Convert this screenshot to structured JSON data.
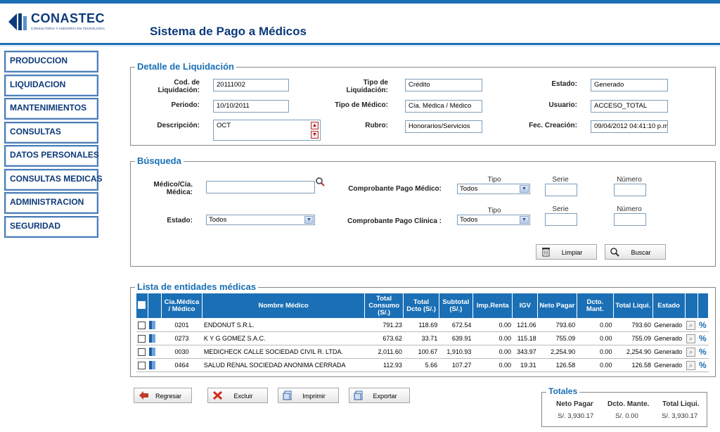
{
  "brand": {
    "name": "CONASTEC",
    "tagline": "CONSULTORIA Y ASESORIA EN TECNOLOGIA"
  },
  "page_title": "Sistema de Pago a Médicos",
  "sidebar": {
    "items": [
      {
        "label": "PRODUCCION"
      },
      {
        "label": "LIQUIDACION"
      },
      {
        "label": "MANTENIMIENTOS"
      },
      {
        "label": "CONSULTAS"
      },
      {
        "label": "DATOS PERSONALES"
      },
      {
        "label": "CONSULTAS MEDICAS"
      },
      {
        "label": "ADMINISTRACION"
      },
      {
        "label": "SEGURIDAD"
      }
    ]
  },
  "detalle": {
    "legend": "Detalle de Liquidación",
    "cod_label": "Cod. de Liquidación:",
    "cod_value": "20111002",
    "periodo_label": "Periodo:",
    "periodo_value": "10/10/2011",
    "desc_label": "Descripción:",
    "desc_value": "OCT",
    "tipo_liq_label": "Tipo de Liquidación:",
    "tipo_liq_value": "Crédito",
    "tipo_med_label": "Tipo de Médico:",
    "tipo_med_value": "Cía. Médica / Médico",
    "rubro_label": "Rubro:",
    "rubro_value": "Honorarios/Servicios",
    "estado_label": "Estado:",
    "estado_value": "Generado",
    "usuario_label": "Usuario:",
    "usuario_value": "ACCESO_TOTAL",
    "fec_label": "Fec. Creación:",
    "fec_value": "09/04/2012 04:41:10 p.m."
  },
  "busqueda": {
    "legend": "Búsqueda",
    "medico_label": "Médico/Cia. Médica:",
    "medico_value": "",
    "estado_label": "Estado:",
    "estado_value": "Todos",
    "comp_med_label": "Comprobante Pago Médico:",
    "comp_cli_label": "Comprobante Pago Clínica :",
    "tipo_label": "Tipo",
    "serie_label": "Serie",
    "numero_label": "Número",
    "tipo_med_value": "Todos",
    "tipo_cli_value": "Todos",
    "limpiar_label": "Limpiar",
    "buscar_label": "Buscar"
  },
  "lista": {
    "legend": "Lista de entidades médicas",
    "headers": {
      "cia": "Cia.Médica / Médico",
      "nombre": "Nombre Médico",
      "consumo": "Total Consumo (S/.)",
      "dcto": "Total Dcto (S/.)",
      "subtotal": "Subtotal (S/.)",
      "renta": "Imp.Renta",
      "igv": "IGV",
      "neto": "Neto Pagar",
      "mant": "Dcto. Mant.",
      "liqui": "Total Liqui.",
      "estado": "Estado"
    },
    "rows": [
      {
        "cia": "0201",
        "nombre": "ENDONUT S.R.L.",
        "consumo": "791.23",
        "dcto": "118.69",
        "subtotal": "672.54",
        "renta": "0.00",
        "igv": "121.06",
        "neto": "793.60",
        "mant": "0.00",
        "liqui": "793.60",
        "estado": "Generado"
      },
      {
        "cia": "0273",
        "nombre": "K Y G GOMEZ S.A.C.",
        "consumo": "673.62",
        "dcto": "33.71",
        "subtotal": "639.91",
        "renta": "0.00",
        "igv": "115.18",
        "neto": "755.09",
        "mant": "0.00",
        "liqui": "755.09",
        "estado": "Generado"
      },
      {
        "cia": "0030",
        "nombre": "MEDICHECK CALLE SOCIEDAD CIVIL R. LTDA.",
        "consumo": "2,011.60",
        "dcto": "100.67",
        "subtotal": "1,910.93",
        "renta": "0.00",
        "igv": "343.97",
        "neto": "2,254.90",
        "mant": "0.00",
        "liqui": "2,254.90",
        "estado": "Generado"
      },
      {
        "cia": "0464",
        "nombre": "SALUD RENAL SOCIEDAD ANONIMA CERRADA",
        "consumo": "112.93",
        "dcto": "5.66",
        "subtotal": "107.27",
        "renta": "0.00",
        "igv": "19.31",
        "neto": "126.58",
        "mant": "0.00",
        "liqui": "126.58",
        "estado": "Generado"
      }
    ]
  },
  "actions": {
    "regresar": "Regresar",
    "excluir": "Excluir",
    "imprimir": "Imprimir",
    "exportar": "Exportar"
  },
  "totales": {
    "legend": "Totales",
    "neto_label": "Neto Pagar",
    "mant_label": "Dcto. Mante.",
    "liqui_label": "Total Liqui.",
    "neto_value": "S/. 3,930.17",
    "mant_value": "S/. 0.00",
    "liqui_value": "S/. 3,930.17"
  },
  "colors": {
    "accent": "#1a6fb5",
    "brand": "#0d3a7a"
  }
}
